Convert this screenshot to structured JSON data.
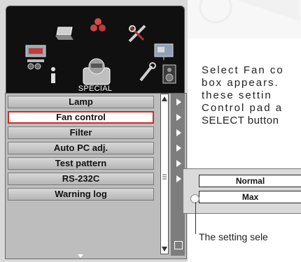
{
  "osd": {
    "section_label": "SPECIAL",
    "icons": [
      "screen-icon",
      "laptop-icon",
      "color-balls-icon",
      "tools-icon",
      "projector-screen-icon",
      "info-icon",
      "speaker-icon",
      "wrench-icon",
      "special-icon"
    ],
    "menu_items": [
      {
        "label": "Lamp",
        "selected": false
      },
      {
        "label": "Fan control",
        "selected": true
      },
      {
        "label": "Filter",
        "selected": false
      },
      {
        "label": "Auto PC adj.",
        "selected": false
      },
      {
        "label": "Test pattern",
        "selected": false
      },
      {
        "label": "RS-232C",
        "selected": false
      },
      {
        "label": "Warning log",
        "selected": false
      }
    ],
    "selected_border_color": "#cc2b2b"
  },
  "subpanel": {
    "options": [
      "Normal",
      "Max"
    ]
  },
  "description": {
    "lines": [
      "Select Fan co",
      "box appears.",
      "these settin",
      "Control pad a",
      "SELECT button"
    ]
  },
  "caption": "The setting sele"
}
